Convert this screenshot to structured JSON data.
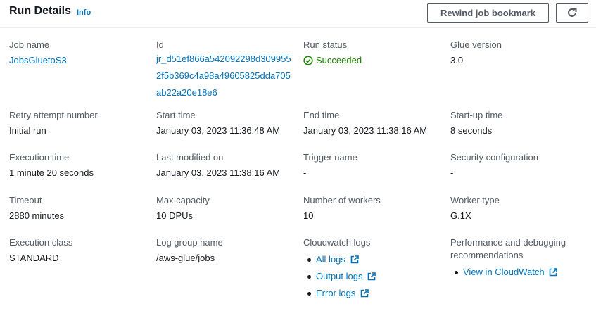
{
  "header": {
    "title": "Run Details",
    "info_label": "Info",
    "rewind_button_label": "Rewind job bookmark",
    "refresh_icon": "refresh-icon"
  },
  "fields": {
    "job_name": {
      "label": "Job name",
      "value": "JobsGluetoS3"
    },
    "id": {
      "label": "Id",
      "value": "jr_d51ef866a542092298d3099552f5b369c4a98a49605825dda705ab22a20e18e6"
    },
    "run_status": {
      "label": "Run status",
      "value": "Succeeded",
      "icon": "check-circle-icon"
    },
    "glue_version": {
      "label": "Glue version",
      "value": "3.0"
    },
    "retry_attempt": {
      "label": "Retry attempt number",
      "value": "Initial run"
    },
    "start_time": {
      "label": "Start time",
      "value": "January 03, 2023 11:36:48 AM"
    },
    "end_time": {
      "label": "End time",
      "value": "January 03, 2023 11:38:16 AM"
    },
    "startup_time": {
      "label": "Start-up time",
      "value": "8 seconds"
    },
    "execution_time": {
      "label": "Execution time",
      "value": "1 minute 20 seconds"
    },
    "last_modified": {
      "label": "Last modified on",
      "value": "January 03, 2023 11:38:16 AM"
    },
    "trigger_name": {
      "label": "Trigger name",
      "value": "-"
    },
    "security_config": {
      "label": "Security configuration",
      "value": "-"
    },
    "timeout": {
      "label": "Timeout",
      "value": "2880 minutes"
    },
    "max_capacity": {
      "label": "Max capacity",
      "value": "10 DPUs"
    },
    "num_workers": {
      "label": "Number of workers",
      "value": "10"
    },
    "worker_type": {
      "label": "Worker type",
      "value": "G.1X"
    },
    "execution_class": {
      "label": "Execution class",
      "value": "STANDARD"
    },
    "log_group": {
      "label": "Log group name",
      "value": "/aws-glue/jobs"
    },
    "cloudwatch_logs": {
      "label": "Cloudwatch logs",
      "links": [
        "All logs",
        "Output logs",
        "Error logs"
      ]
    },
    "performance": {
      "label": "Performance and debugging recommendations",
      "links": [
        "View in CloudWatch"
      ]
    }
  },
  "colors": {
    "link": "#0073bb",
    "success": "#1d8102",
    "label": "#545b64"
  }
}
